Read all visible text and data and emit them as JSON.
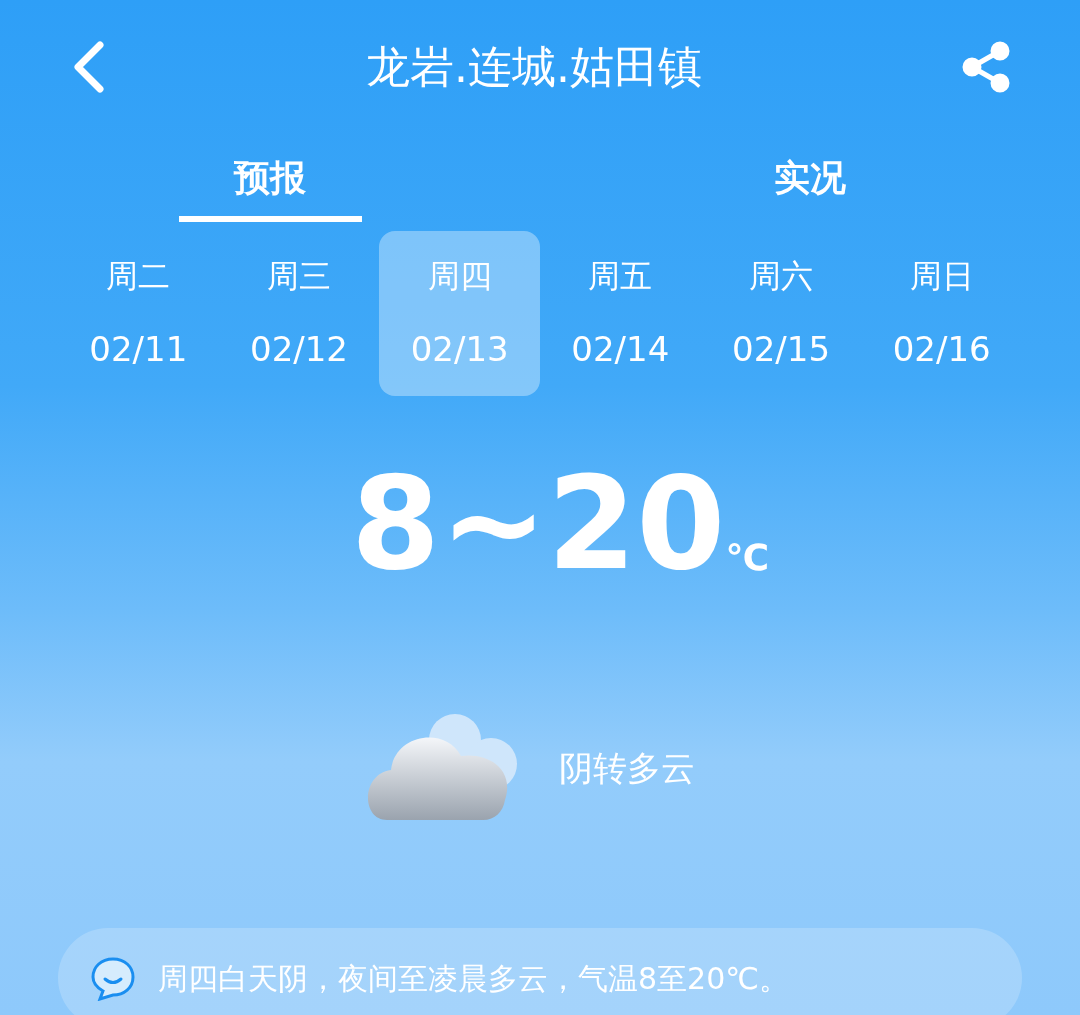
{
  "header": {
    "title": "龙岩.连城.姑田镇"
  },
  "tabs": [
    {
      "label": "预报",
      "selected": true
    },
    {
      "label": "实况",
      "selected": false
    }
  ],
  "days": [
    {
      "weekday": "周二",
      "date": "02/11",
      "selected": false
    },
    {
      "weekday": "周三",
      "date": "02/12",
      "selected": false
    },
    {
      "weekday": "周四",
      "date": "02/13",
      "selected": true
    },
    {
      "weekday": "周五",
      "date": "02/14",
      "selected": false
    },
    {
      "weekday": "周六",
      "date": "02/15",
      "selected": false
    },
    {
      "weekday": "周日",
      "date": "02/16",
      "selected": false
    }
  ],
  "temperature": {
    "range": "8~20",
    "unit": "℃"
  },
  "condition": "阴转多云",
  "summary": "周四白天阴，夜间至凌晨多云，气温8至20℃。"
}
